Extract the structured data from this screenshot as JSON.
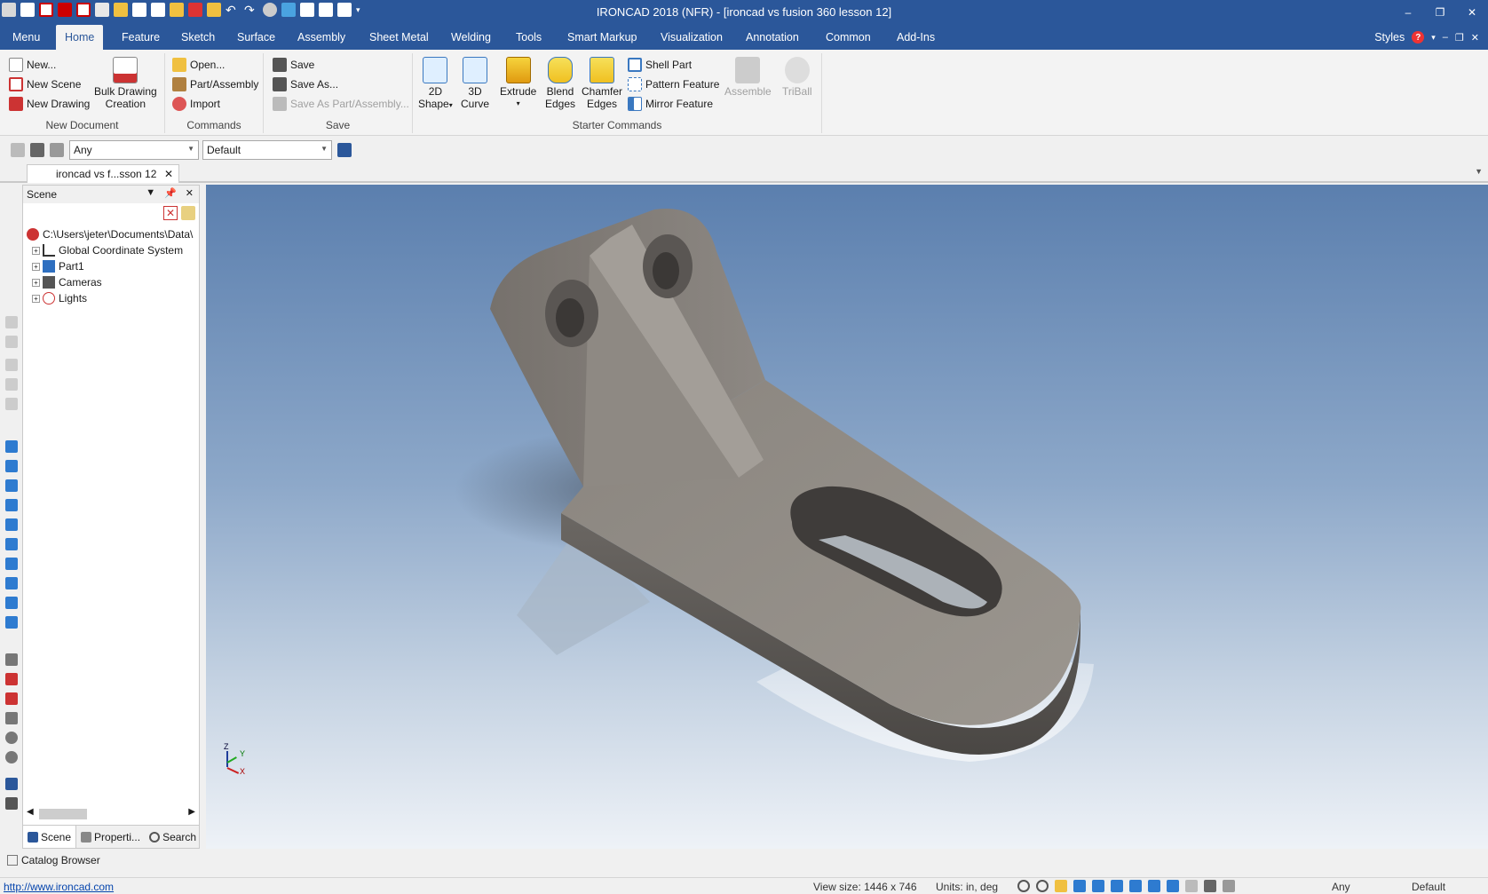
{
  "app": {
    "title": "IRONCAD 2018 (NFR) - [ironcad vs fusion 360 lesson 12]"
  },
  "window_controls": {
    "minimize": "–",
    "restore": "❐",
    "close": "✕"
  },
  "ribbon_tabs": [
    {
      "label": "Menu"
    },
    {
      "label": "Home",
      "active": true
    },
    {
      "label": "Feature"
    },
    {
      "label": "Sketch"
    },
    {
      "label": "Surface"
    },
    {
      "label": "Assembly"
    },
    {
      "label": "Sheet Metal"
    },
    {
      "label": "Welding"
    },
    {
      "label": "Tools"
    },
    {
      "label": "Smart Markup"
    },
    {
      "label": "Visualization"
    },
    {
      "label": "Annotation"
    },
    {
      "label": "Common"
    },
    {
      "label": "Add-Ins"
    }
  ],
  "ribbon_right": {
    "styles": "Styles",
    "help": "?"
  },
  "ribbon": {
    "new_document": {
      "label": "New Document",
      "new": "New...",
      "new_scene": "New Scene",
      "new_drawing": "New Drawing",
      "bulk_drawing_line1": "Bulk Drawing",
      "bulk_drawing_line2": "Creation"
    },
    "commands": {
      "label": "Commands",
      "open": "Open...",
      "part_assembly": "Part/Assembly",
      "import": "Import"
    },
    "save": {
      "label": "Save",
      "save": "Save",
      "save_as": "Save As...",
      "save_as_part": "Save As Part/Assembly..."
    },
    "starter": {
      "label": "Starter Commands",
      "shape_2d_line1": "2D",
      "shape_2d_line2": "Shape",
      "curve_3d_line1": "3D",
      "curve_3d_line2": "Curve",
      "extrude": "Extrude",
      "blend_line1": "Blend",
      "blend_line2": "Edges",
      "chamfer_line1": "Chamfer",
      "chamfer_line2": "Edges",
      "shell_part": "Shell Part",
      "pattern_feature": "Pattern Feature",
      "mirror_feature": "Mirror Feature",
      "assemble": "Assemble",
      "triball": "TriBall"
    }
  },
  "toolbar": {
    "filter_value": "Any",
    "style_value": "Default"
  },
  "document_tab": {
    "label": "ironcad vs f...sson 12"
  },
  "scene_panel": {
    "title": "Scene",
    "tree": [
      {
        "label": "C:\\Users\\jeter\\Documents\\Data\\"
      },
      {
        "label": "Global Coordinate System"
      },
      {
        "label": "Part1"
      },
      {
        "label": "Cameras"
      },
      {
        "label": "Lights"
      }
    ],
    "tabs": [
      {
        "label": "Scene"
      },
      {
        "label": "Properti..."
      },
      {
        "label": "Search"
      }
    ]
  },
  "viewport": {
    "triad": {
      "z": "Z",
      "y": "Y",
      "x": "X"
    }
  },
  "catalog": {
    "label": "Catalog Browser"
  },
  "status": {
    "link": "http://www.ironcad.com",
    "view_size": "View size: 1446 x  746",
    "units": "Units: in, deg",
    "filter": "Any",
    "style": "Default"
  },
  "colors": {
    "ribbon_blue": "#2b579a",
    "part_gray": "#8f8b86",
    "viewport_top": "#5b7fae",
    "viewport_bottom": "#eef2f7"
  }
}
